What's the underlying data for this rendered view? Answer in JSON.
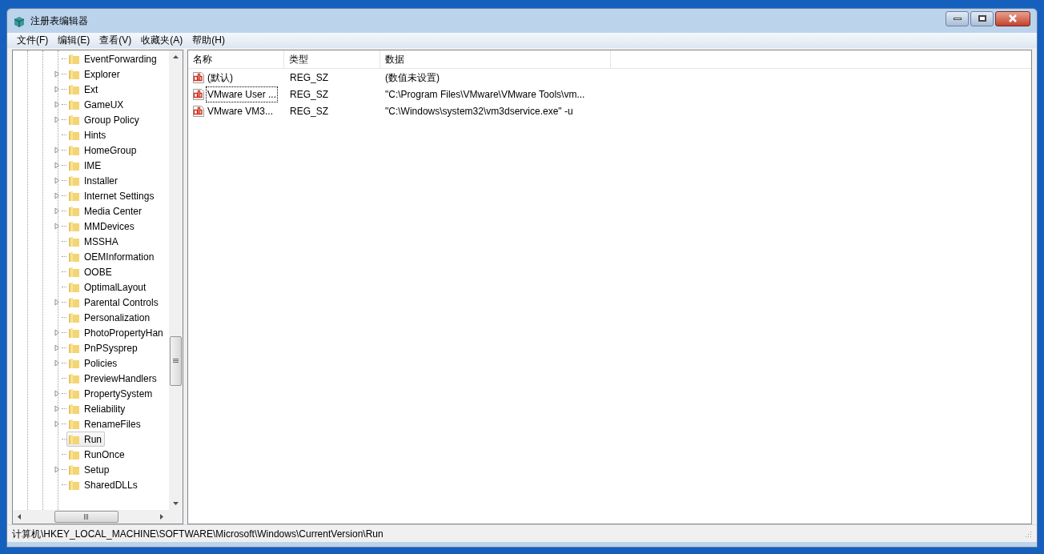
{
  "window": {
    "title": "注册表编辑器"
  },
  "menu": [
    "文件(F)",
    "编辑(E)",
    "查看(V)",
    "收藏夹(A)",
    "帮助(H)"
  ],
  "tree": {
    "items": [
      {
        "label": "EventForwarding",
        "has_children": false,
        "selected": false
      },
      {
        "label": "Explorer",
        "has_children": true,
        "selected": false
      },
      {
        "label": "Ext",
        "has_children": true,
        "selected": false
      },
      {
        "label": "GameUX",
        "has_children": true,
        "selected": false
      },
      {
        "label": "Group Policy",
        "has_children": true,
        "selected": false
      },
      {
        "label": "Hints",
        "has_children": false,
        "selected": false
      },
      {
        "label": "HomeGroup",
        "has_children": true,
        "selected": false
      },
      {
        "label": "IME",
        "has_children": true,
        "selected": false
      },
      {
        "label": "Installer",
        "has_children": true,
        "selected": false
      },
      {
        "label": "Internet Settings",
        "has_children": true,
        "selected": false
      },
      {
        "label": "Media Center",
        "has_children": true,
        "selected": false
      },
      {
        "label": "MMDevices",
        "has_children": true,
        "selected": false
      },
      {
        "label": "MSSHA",
        "has_children": false,
        "selected": false
      },
      {
        "label": "OEMInformation",
        "has_children": false,
        "selected": false
      },
      {
        "label": "OOBE",
        "has_children": false,
        "selected": false
      },
      {
        "label": "OptimalLayout",
        "has_children": false,
        "selected": false
      },
      {
        "label": "Parental Controls",
        "has_children": true,
        "selected": false
      },
      {
        "label": "Personalization",
        "has_children": false,
        "selected": false
      },
      {
        "label": "PhotoPropertyHan",
        "has_children": true,
        "selected": false
      },
      {
        "label": "PnPSysprep",
        "has_children": true,
        "selected": false
      },
      {
        "label": "Policies",
        "has_children": true,
        "selected": false
      },
      {
        "label": "PreviewHandlers",
        "has_children": false,
        "selected": false
      },
      {
        "label": "PropertySystem",
        "has_children": true,
        "selected": false
      },
      {
        "label": "Reliability",
        "has_children": true,
        "selected": false
      },
      {
        "label": "RenameFiles",
        "has_children": true,
        "selected": false
      },
      {
        "label": "Run",
        "has_children": false,
        "selected": true
      },
      {
        "label": "RunOnce",
        "has_children": false,
        "selected": false
      },
      {
        "label": "Setup",
        "has_children": true,
        "selected": false
      },
      {
        "label": "SharedDLLs",
        "has_children": false,
        "selected": false
      }
    ]
  },
  "table": {
    "columns": [
      "名称",
      "类型",
      "数据"
    ],
    "rows": [
      {
        "name": "(默认)",
        "type": "REG_SZ",
        "data": "(数值未设置)",
        "focused": false
      },
      {
        "name": "VMware User ...",
        "type": "REG_SZ",
        "data": "\"C:\\Program Files\\VMware\\VMware Tools\\vm...",
        "focused": true
      },
      {
        "name": "VMware VM3...",
        "type": "REG_SZ",
        "data": "\"C:\\Windows\\system32\\vm3dservice.exe\" -u",
        "focused": false
      }
    ]
  },
  "status_bar": "计算机\\HKEY_LOCAL_MACHINE\\SOFTWARE\\Microsoft\\Windows\\CurrentVersion\\Run"
}
